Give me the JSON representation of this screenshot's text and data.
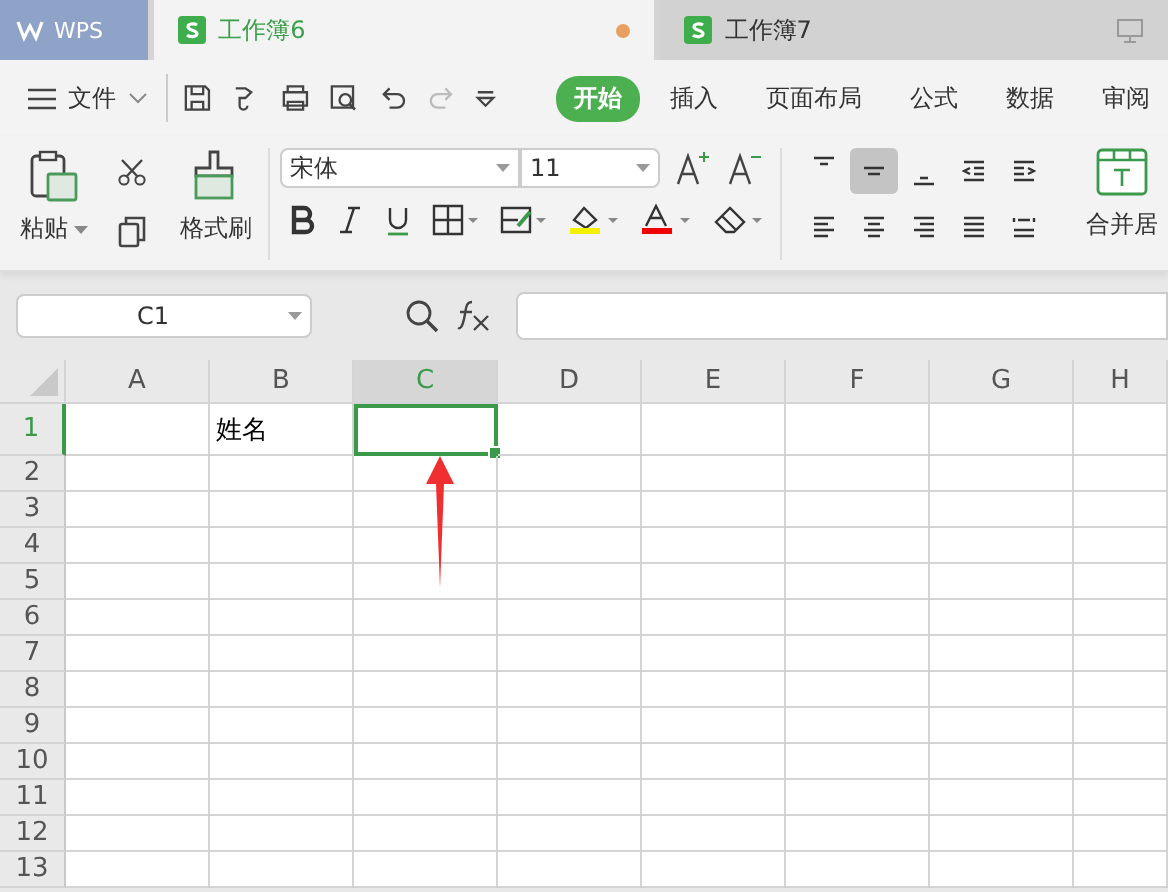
{
  "app_button": {
    "label": "WPS"
  },
  "doc_tabs": [
    {
      "label": "工作簿6",
      "selected": true,
      "unsaved": true
    },
    {
      "label": "工作簿7",
      "selected": false,
      "unsaved": false
    }
  ],
  "file_menu": {
    "label": "文件"
  },
  "ribbon_tabs": [
    {
      "label": "开始",
      "selected": true
    },
    {
      "label": "插入",
      "selected": false
    },
    {
      "label": "页面布局",
      "selected": false
    },
    {
      "label": "公式",
      "selected": false
    },
    {
      "label": "数据",
      "selected": false
    },
    {
      "label": "审阅",
      "selected": false
    }
  ],
  "clipboard": {
    "paste": "粘贴",
    "format_painter": "格式刷"
  },
  "font": {
    "name": "宋体",
    "size": "11"
  },
  "alignment_buttons": [
    {
      "kind": "top",
      "selected": false
    },
    {
      "kind": "middle",
      "selected": true
    },
    {
      "kind": "bottom",
      "selected": false
    },
    {
      "kind": "outdent",
      "selected": false
    },
    {
      "kind": "indent",
      "selected": false
    },
    {
      "kind": "left",
      "selected": false
    },
    {
      "kind": "center",
      "selected": false
    },
    {
      "kind": "right",
      "selected": false
    },
    {
      "kind": "justify",
      "selected": false
    },
    {
      "kind": "distribute",
      "selected": false
    }
  ],
  "merge_button": {
    "label": "合并居"
  },
  "formula_bar": {
    "name_box": "C1"
  },
  "sheet": {
    "columns": [
      {
        "label": "A",
        "selected": false
      },
      {
        "label": "B",
        "selected": false,
        "cells": [
          "姓名"
        ]
      },
      {
        "label": "C",
        "selected": true
      },
      {
        "label": "D",
        "selected": false
      },
      {
        "label": "E",
        "selected": false
      },
      {
        "label": "F",
        "selected": false
      },
      {
        "label": "G",
        "selected": false
      },
      {
        "label": "H",
        "selected": false
      }
    ],
    "rows": [
      {
        "label": "1",
        "selected": true
      },
      {
        "label": "2",
        "selected": false
      },
      {
        "label": "3",
        "selected": false
      },
      {
        "label": "4",
        "selected": false
      },
      {
        "label": "5",
        "selected": false
      },
      {
        "label": "6",
        "selected": false
      },
      {
        "label": "7",
        "selected": false
      },
      {
        "label": "8",
        "selected": false
      },
      {
        "label": "9",
        "selected": false
      },
      {
        "label": "10",
        "selected": false
      },
      {
        "label": "11",
        "selected": false
      },
      {
        "label": "12",
        "selected": false
      },
      {
        "label": "13",
        "selected": false
      }
    ]
  },
  "annotation": {
    "kind": "arrow"
  }
}
